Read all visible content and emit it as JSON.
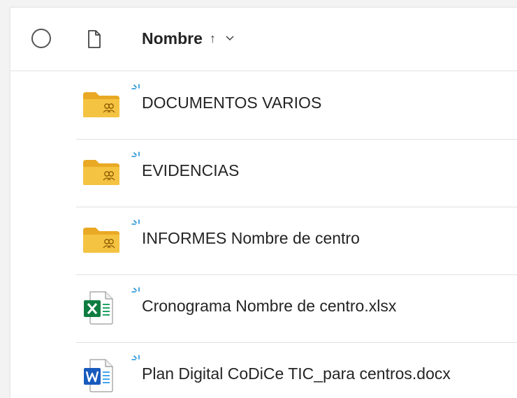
{
  "header": {
    "column_name_label": "Nombre",
    "sort_arrow": "↑"
  },
  "files": [
    {
      "name": "DOCUMENTOS VARIOS",
      "type": "shared-folder",
      "icon": "shared-folder-icon"
    },
    {
      "name": "EVIDENCIAS",
      "type": "shared-folder",
      "icon": "shared-folder-icon"
    },
    {
      "name": "INFORMES Nombre de centro",
      "type": "shared-folder",
      "icon": "shared-folder-icon"
    },
    {
      "name": "Cronograma Nombre de centro.xlsx",
      "type": "excel",
      "icon": "excel-file-icon"
    },
    {
      "name": "Plan Digital CoDiCe TIC_para centros.docx",
      "type": "word",
      "icon": "word-file-icon"
    }
  ],
  "colors": {
    "folder": "#f5c342",
    "folder_dark": "#e9a924",
    "excel": "#107c41",
    "word": "#185abd",
    "sync_accent": "#1a8fd6"
  }
}
